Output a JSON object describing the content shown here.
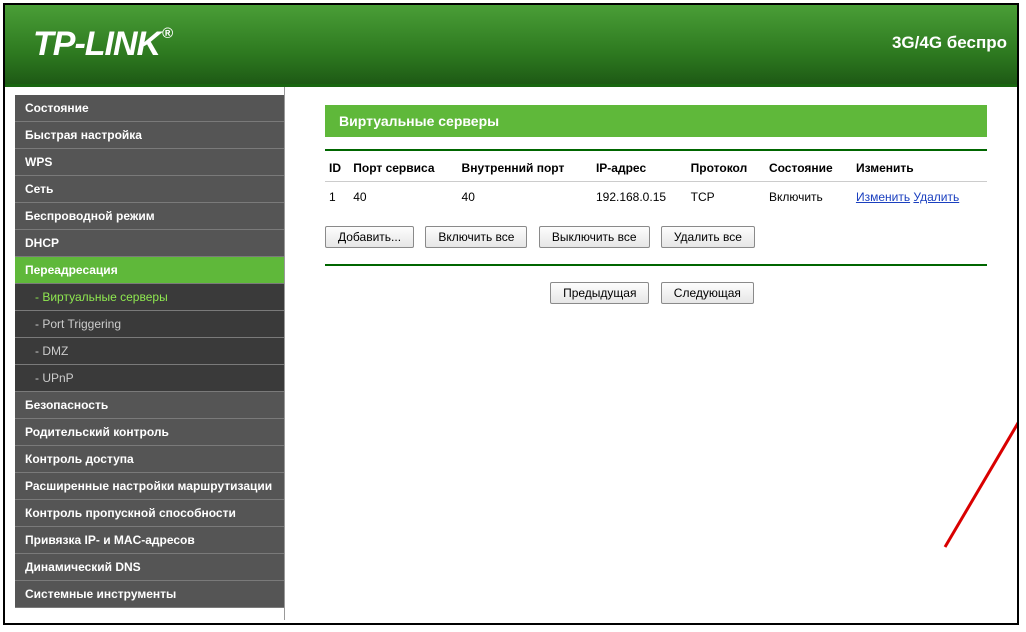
{
  "header": {
    "logo": "TP-LINK",
    "reg": "®",
    "model": "3G/4G беспро"
  },
  "sidebar": {
    "items": [
      {
        "label": "Состояние",
        "type": "item"
      },
      {
        "label": "Быстрая настройка",
        "type": "item"
      },
      {
        "label": "WPS",
        "type": "item"
      },
      {
        "label": "Сеть",
        "type": "item"
      },
      {
        "label": "Беспроводной режим",
        "type": "item"
      },
      {
        "label": "DHCP",
        "type": "item"
      },
      {
        "label": "Переадресация",
        "type": "active"
      },
      {
        "label": "- Виртуальные серверы",
        "type": "sub-active"
      },
      {
        "label": "- Port Triggering",
        "type": "sub"
      },
      {
        "label": "- DMZ",
        "type": "sub"
      },
      {
        "label": "- UPnP",
        "type": "sub"
      },
      {
        "label": "Безопасность",
        "type": "item"
      },
      {
        "label": "Родительский контроль",
        "type": "item"
      },
      {
        "label": "Контроль доступа",
        "type": "item"
      },
      {
        "label": "Расширенные настройки маршрутизации",
        "type": "item"
      },
      {
        "label": "Контроль пропускной способности",
        "type": "item"
      },
      {
        "label": "Привязка IP- и MAC-адресов",
        "type": "item"
      },
      {
        "label": "Динамический DNS",
        "type": "item"
      },
      {
        "label": "Системные инструменты",
        "type": "item"
      }
    ]
  },
  "main": {
    "title": "Виртуальные серверы",
    "headers": {
      "id": "ID",
      "service_port": "Порт сервиса",
      "internal_port": "Внутренний порт",
      "ip": "IP-адрес",
      "protocol": "Протокол",
      "status": "Состояние",
      "modify": "Изменить"
    },
    "rows": [
      {
        "id": "1",
        "service_port": "40",
        "internal_port": "40",
        "ip": "192.168.0.15",
        "protocol": "TCP",
        "status": "Включить",
        "edit_link": "Изменить",
        "delete_link": "Удалить"
      }
    ],
    "buttons": {
      "add": "Добавить...",
      "enable_all": "Включить все",
      "disable_all": "Выключить все",
      "delete_all": "Удалить все"
    },
    "nav": {
      "prev": "Предыдущая",
      "next": "Следующая"
    }
  }
}
